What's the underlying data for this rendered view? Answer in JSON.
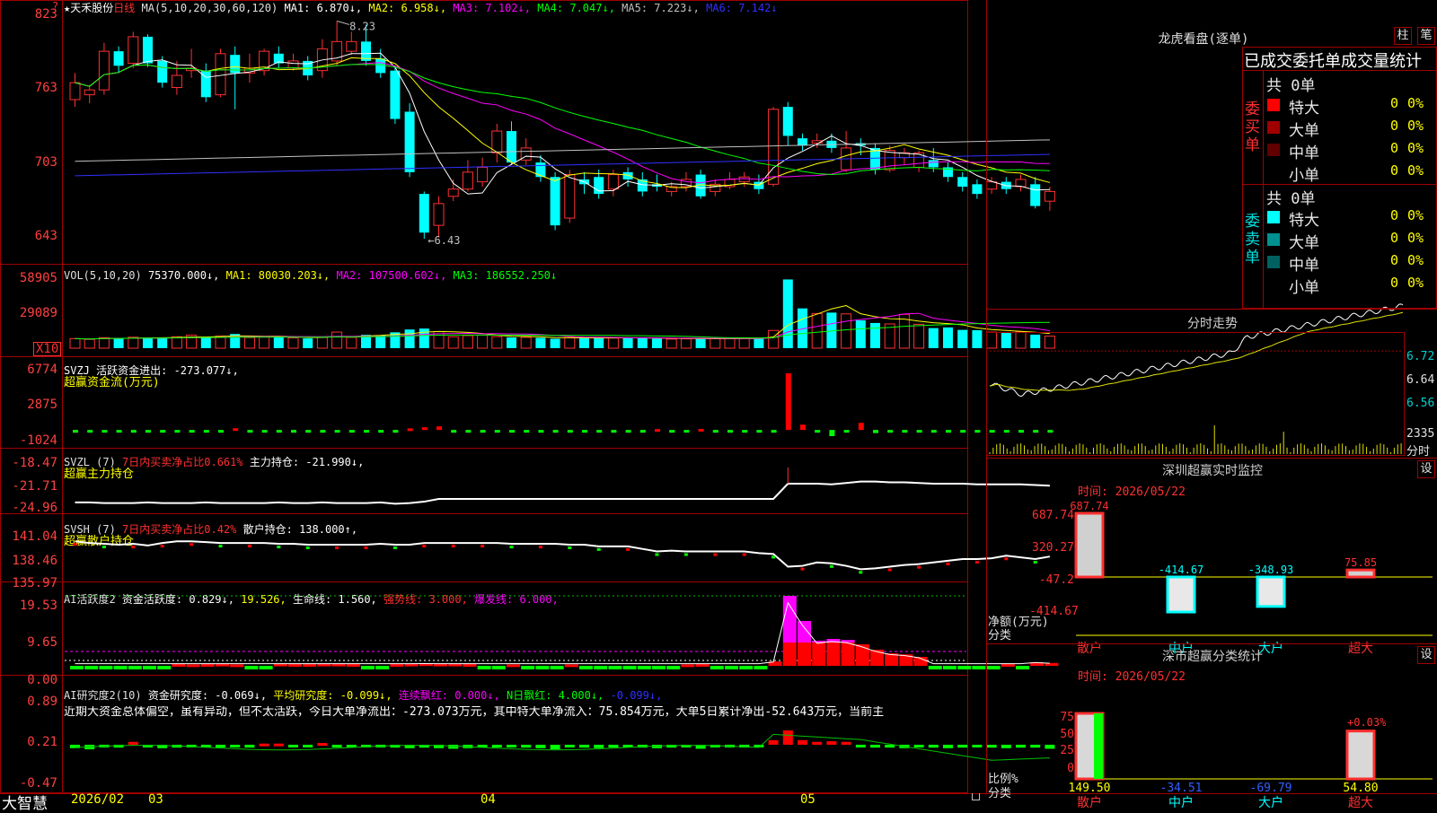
{
  "stock": {
    "star": "★",
    "name": "天禾股份",
    "period": "日线"
  },
  "ma_header": {
    "label": "MA(5,10,20,30,60,120)",
    "items": [
      {
        "text": "MA1: 6.870↓,",
        "color": "#ffffff"
      },
      {
        "text": "MA2: 6.958↓,",
        "color": "#ffff00"
      },
      {
        "text": "MA3: 7.102↓,",
        "color": "#ff00ff"
      },
      {
        "text": "MA4: 7.047↓,",
        "color": "#00ff00"
      },
      {
        "text": "MA5: 7.223↓,",
        "color": "#c0c0c0"
      },
      {
        "text": "MA6: 7.142↓",
        "color": "#3030ff"
      }
    ],
    "high_label": "8.23",
    "low_label": "←6.43"
  },
  "y_axes": {
    "price": [
      "823",
      "763",
      "703",
      "643"
    ],
    "vol": [
      "58905",
      "29089"
    ],
    "vol_unit": "X10",
    "svzj": [
      "6774",
      "2875",
      "-1024"
    ],
    "svzl": [
      "-18.47",
      "-21.71",
      "-24.96"
    ],
    "svsh": [
      "141.04",
      "138.46",
      "135.97"
    ],
    "ai": [
      "19.53",
      "9.65",
      "0.00"
    ],
    "air": [
      "0.89",
      "0.21",
      "-0.47"
    ]
  },
  "vol_header": {
    "label": "VOL(5,10,20)",
    "value": "75370.000↓,",
    "items": [
      {
        "text": "MA1: 80030.203↓,",
        "color": "#ffff00"
      },
      {
        "text": "MA2: 107500.602↓,",
        "color": "#ff00ff"
      },
      {
        "text": "MA3: 186552.250↓",
        "color": "#00ff00"
      }
    ]
  },
  "svzj_header": {
    "line1": "SVZJ  活跃资金进出: -273.077↓,",
    "line2": "超赢资金流(万元)"
  },
  "svzl_header": {
    "prefix": "SVZL (7)",
    "red": "7日内买卖净占比0.661%",
    "rest": "主力持仓: -21.990↓,",
    "line2": "超赢主力持仓"
  },
  "svsh_header": {
    "prefix": "SVSH (7)",
    "red": "7日内买卖净占比0.42%",
    "rest": "散户持仓: 138.000↑,",
    "line2": "超赢散户持仓"
  },
  "ai_header": {
    "label": "AI活跃度2",
    "items": [
      {
        "text": "资金活跃度: 0.829↓,",
        "color": "#ffffff"
      },
      {
        "text": "19.526,",
        "color": "#ffff00"
      },
      {
        "text": "生命线: 1.560,",
        "color": "#ffffff"
      },
      {
        "text": "强势线: 3.000,",
        "color": "#ff3030"
      },
      {
        "text": "爆发线: 6.000,",
        "color": "#ff00ff"
      }
    ]
  },
  "air_header": {
    "label": "AI研究度2(10)",
    "items": [
      {
        "text": "资金研究度: -0.069↓,",
        "color": "#ffffff"
      },
      {
        "text": "平均研究度: -0.099↓,",
        "color": "#ffff00"
      },
      {
        "text": "连续飘红: 0.000↓,",
        "color": "#ff00ff"
      },
      {
        "text": "N日飘红: 4.000↓,",
        "color": "#00ff00"
      },
      {
        "text": "-0.099↓,",
        "color": "#3030ff"
      }
    ],
    "comment": "近期大资金总体偏空，虽有异动，但不太活跃，今日大单净流出：-273.073万元，其中特大单净流入：75.854万元，大单5日累计净出-52.643万元，当前主"
  },
  "bottom_bar": {
    "brand": "大智慧",
    "x_labels": [
      "2026/02",
      "03",
      "04",
      "05"
    ]
  },
  "dragon": {
    "title": "龙虎看盘(逐单)",
    "btn_zhu": "柱",
    "btn_bi": "笔",
    "sub_title": "已成交委托单成交量统计",
    "buy_side": "委买单",
    "sell_side": "委卖单",
    "buy_total": "共 0单",
    "sell_total": "共 0单",
    "buy_rows": [
      {
        "name": "特大",
        "count": "0",
        "pct": "0%",
        "color": "#ff0000"
      },
      {
        "name": "大单",
        "count": "0",
        "pct": "0%",
        "color": "#a00000"
      },
      {
        "name": "中单",
        "count": "0",
        "pct": "0%",
        "color": "#600000"
      },
      {
        "name": "小单",
        "count": "0",
        "pct": "0%",
        "color": "#000000"
      }
    ],
    "sell_rows": [
      {
        "name": "特大",
        "count": "0",
        "pct": "0%",
        "color": "#00ffff"
      },
      {
        "name": "大单",
        "count": "0",
        "pct": "0%",
        "color": "#009090"
      },
      {
        "name": "中单",
        "count": "0",
        "pct": "0%",
        "color": "#006060"
      },
      {
        "name": "小单",
        "count": "0",
        "pct": "0%",
        "color": "#000000"
      }
    ]
  },
  "minute": {
    "title": "分时走势",
    "y_labels": [
      "6.72",
      "6.64",
      "6.56"
    ],
    "vol_label": "2335",
    "vol_unit": "分时"
  },
  "monitor": {
    "title": "深圳超赢实时监控",
    "btn": "设",
    "time": "时间: 2026/05/22",
    "y_labels": [
      "687.74",
      "320.27",
      "-47.2",
      "-414.67"
    ],
    "y_title": "净额(万元)",
    "x_title": "分类"
  },
  "classify": {
    "title": "深市超赢分类统计",
    "btn": "设",
    "time": "时间: 2026/05/22",
    "y_labels": [
      "75",
      "50",
      "25",
      "0"
    ],
    "pct_label": "+0.03%",
    "y_title": "比例%",
    "x_title": "分类"
  },
  "chart_data": [
    {
      "type": "candlestick",
      "title": "天禾股份 日线",
      "ylim": [
        6.4,
        8.3
      ],
      "candles": [
        [
          7.58,
          7.72,
          7.8,
          7.52
        ],
        [
          7.62,
          7.66,
          7.7,
          7.55
        ],
        [
          7.66,
          7.98,
          8.05,
          7.62
        ],
        [
          7.98,
          7.86,
          8.02,
          7.8
        ],
        [
          7.88,
          8.1,
          8.14,
          7.84
        ],
        [
          8.1,
          7.88,
          8.12,
          7.85
        ],
        [
          7.9,
          7.72,
          7.94,
          7.68
        ],
        [
          7.68,
          7.78,
          7.9,
          7.62
        ],
        [
          7.82,
          7.84,
          8.0,
          7.76
        ],
        [
          7.82,
          7.6,
          7.88,
          7.56
        ],
        [
          7.62,
          7.96,
          8.0,
          7.6
        ],
        [
          7.95,
          7.8,
          8.02,
          7.5
        ],
        [
          7.8,
          7.84,
          7.96,
          7.72
        ],
        [
          7.82,
          7.98,
          8.0,
          7.78
        ],
        [
          7.96,
          7.88,
          8.02,
          7.84
        ],
        [
          7.84,
          7.9,
          7.96,
          7.82
        ],
        [
          7.9,
          7.78,
          7.94,
          7.74
        ],
        [
          7.82,
          8.0,
          8.08,
          7.76
        ],
        [
          7.9,
          8.06,
          8.23,
          7.86
        ],
        [
          7.98,
          8.06,
          8.14,
          7.95
        ],
        [
          8.06,
          7.9,
          8.2,
          7.86
        ],
        [
          7.92,
          7.8,
          8.0,
          7.76
        ],
        [
          7.82,
          7.42,
          7.86,
          7.38
        ],
        [
          7.48,
          6.98,
          7.55,
          6.94
        ],
        [
          6.8,
          6.48,
          6.82,
          6.43
        ],
        [
          6.54,
          6.72,
          6.78,
          6.44
        ],
        [
          6.78,
          6.84,
          6.92,
          6.74
        ],
        [
          6.84,
          6.98,
          7.08,
          6.82
        ],
        [
          6.9,
          7.02,
          7.1,
          6.86
        ],
        [
          7.14,
          7.32,
          7.38,
          7.06
        ],
        [
          7.32,
          7.06,
          7.4,
          7.04
        ],
        [
          7.08,
          7.18,
          7.26,
          7.04
        ],
        [
          7.06,
          6.94,
          7.12,
          6.9
        ],
        [
          6.94,
          6.54,
          6.98,
          6.5
        ],
        [
          6.6,
          6.96,
          7.0,
          6.56
        ],
        [
          6.92,
          6.88,
          6.98,
          6.8
        ],
        [
          6.94,
          6.8,
          7.0,
          6.76
        ],
        [
          6.84,
          6.96,
          7.0,
          6.78
        ],
        [
          6.98,
          6.92,
          7.02,
          6.86
        ],
        [
          6.92,
          6.82,
          6.98,
          6.78
        ],
        [
          6.88,
          6.86,
          6.96,
          6.82
        ],
        [
          6.82,
          6.86,
          6.9,
          6.78
        ],
        [
          6.86,
          6.92,
          6.98,
          6.82
        ],
        [
          6.96,
          6.78,
          7.0,
          6.76
        ],
        [
          6.82,
          6.88,
          6.92,
          6.78
        ],
        [
          6.86,
          6.92,
          6.98,
          6.84
        ],
        [
          6.9,
          6.94,
          6.98,
          6.86
        ],
        [
          6.9,
          6.84,
          6.96,
          6.8
        ],
        [
          6.88,
          7.5,
          7.52,
          6.86
        ],
        [
          7.52,
          7.28,
          7.56,
          7.2
        ],
        [
          7.26,
          7.2,
          7.3,
          7.16
        ],
        [
          7.22,
          7.24,
          7.3,
          7.18
        ],
        [
          7.24,
          7.18,
          7.3,
          7.14
        ],
        [
          7.0,
          7.18,
          7.32,
          6.98
        ],
        [
          7.22,
          7.2,
          7.26,
          7.12
        ],
        [
          7.18,
          7.0,
          7.22,
          6.96
        ],
        [
          7.0,
          7.16,
          7.2,
          6.98
        ],
        [
          7.1,
          7.14,
          7.18,
          7.04
        ],
        [
          7.02,
          7.14,
          7.16,
          6.98
        ],
        [
          7.08,
          7.02,
          7.18,
          6.98
        ],
        [
          7.02,
          6.94,
          7.06,
          6.9
        ],
        [
          6.94,
          6.86,
          6.98,
          6.82
        ],
        [
          6.88,
          6.8,
          6.92,
          6.76
        ],
        [
          6.84,
          6.9,
          6.94,
          6.8
        ],
        [
          6.9,
          6.84,
          6.94,
          6.8
        ],
        [
          6.86,
          6.92,
          6.96,
          6.82
        ],
        [
          6.88,
          6.7,
          6.94,
          6.68
        ],
        [
          6.74,
          6.82,
          6.86,
          6.66
        ]
      ]
    },
    {
      "type": "bar",
      "title": "VOL(5,10,20)",
      "ylim": [
        0,
        60000
      ],
      "values": [
        8200,
        7600,
        9000,
        8800,
        9400,
        9000,
        8600,
        9800,
        11200,
        9500,
        10400,
        12200,
        9100,
        9600,
        10000,
        8800,
        8400,
        9300,
        13800,
        9300,
        11400,
        11000,
        13600,
        16000,
        16800,
        14200,
        9800,
        10800,
        11200,
        9900,
        9200,
        9300,
        8900,
        8100,
        9200,
        8700,
        8900,
        8800,
        8900,
        8500,
        8300,
        7800,
        8000,
        8100,
        8200,
        8200,
        8400,
        8100,
        15200,
        58900,
        34100,
        29700,
        30500,
        29400,
        23900,
        21600,
        20800,
        29000,
        20500,
        17200,
        17800,
        15700,
        15400,
        13800,
        13200,
        14100,
        11600,
        10300
      ]
    },
    {
      "type": "bar",
      "title": "SVZJ 活跃资金进出",
      "ylim": [
        -1100,
        6800
      ],
      "values": [
        -200,
        -180,
        -150,
        -160,
        -100,
        -120,
        -140,
        -110,
        -90,
        -120,
        -150,
        200,
        -100,
        -110,
        -130,
        -90,
        -100,
        -110,
        -80,
        -120,
        -100,
        -130,
        -160,
        180,
        300,
        400,
        -200,
        -180,
        -150,
        -90,
        -110,
        -120,
        -100,
        -140,
        -160,
        -110,
        -90,
        -130,
        -100,
        -90,
        100,
        -120,
        -100,
        120,
        -80,
        -110,
        -90,
        -100,
        -150,
        6400,
        600,
        -180,
        -700,
        -200,
        800,
        -350,
        -200,
        -180,
        -160,
        -150,
        -190,
        -220,
        -200,
        -170,
        -160,
        -180,
        -150,
        -273
      ]
    },
    {
      "type": "line",
      "title": "SVZL 主力持仓",
      "ylim": [
        -25.2,
        -18.2
      ],
      "values": [
        -24.4,
        -24.4,
        -24.5,
        -24.5,
        -24.5,
        -24.4,
        -24.5,
        -24.5,
        -24.5,
        -24.4,
        -24.5,
        -24.5,
        -24.5,
        -24.5,
        -24.4,
        -24.5,
        -24.5,
        -24.4,
        -24.5,
        -24.5,
        -24.5,
        -24.4,
        -24.6,
        -24.5,
        -24.3,
        -23.9,
        -23.9,
        -23.9,
        -23.9,
        -23.9,
        -23.9,
        -23.9,
        -23.9,
        -23.9,
        -23.9,
        -23.9,
        -23.9,
        -23.9,
        -23.9,
        -23.9,
        -23.9,
        -23.9,
        -23.9,
        -23.9,
        -23.9,
        -23.9,
        -23.9,
        -23.9,
        -23.9,
        -21.7,
        -21.7,
        -21.7,
        -21.8,
        -21.6,
        -21.4,
        -21.4,
        -21.5,
        -21.5,
        -21.6,
        -21.7,
        -21.7,
        -21.7,
        -21.8,
        -21.8,
        -21.8,
        -21.8,
        -21.9,
        -21.99
      ]
    },
    {
      "type": "line",
      "title": "SVSH 散户持仓",
      "ylim": [
        135.9,
        141.2
      ],
      "values": [
        139.8,
        139.6,
        139.5,
        139.4,
        139.5,
        139.3,
        139.6,
        139.8,
        139.8,
        139.7,
        139.6,
        139.6,
        139.6,
        139.6,
        139.5,
        139.5,
        139.4,
        139.4,
        139.4,
        139.4,
        139.4,
        139.5,
        139.4,
        139.4,
        139.6,
        139.6,
        139.6,
        139.6,
        139.6,
        139.6,
        139.5,
        139.5,
        139.5,
        139.5,
        139.4,
        139.4,
        139.2,
        139.2,
        139.2,
        138.9,
        138.6,
        138.7,
        138.6,
        138.6,
        138.6,
        138.6,
        138.6,
        138.4,
        138.3,
        136.8,
        136.9,
        137.3,
        137.2,
        136.9,
        136.5,
        136.6,
        136.8,
        137.0,
        137.1,
        137.3,
        137.5,
        137.7,
        137.7,
        137.8,
        138.1,
        137.9,
        137.7,
        138.0
      ]
    },
    {
      "type": "bar",
      "title": "AI活跃度2",
      "ylim": [
        -0.8,
        20.5
      ],
      "thresholds": [
        3.0,
        6.0
      ],
      "values": [
        -0.5,
        -0.4,
        -0.6,
        -0.5,
        -0.5,
        -0.4,
        -0.5,
        0.5,
        0.4,
        0.5,
        0.6,
        0.4,
        -0.5,
        -0.5,
        0.6,
        0.5,
        0.5,
        0.6,
        0.6,
        0.5,
        -0.4,
        -0.5,
        0.5,
        0.6,
        0.7,
        0.6,
        0.6,
        0.5,
        -0.4,
        -0.5,
        0.4,
        -0.5,
        -0.5,
        -0.6,
        0.4,
        -0.4,
        -0.5,
        -0.5,
        -0.4,
        -0.4,
        -0.4,
        -0.5,
        0.4,
        0.5,
        -0.5,
        -0.4,
        -0.5,
        -0.4,
        1.2,
        19.5,
        12.5,
        7.0,
        7.5,
        7.2,
        6.0,
        4.5,
        3.5,
        3.2,
        2.5,
        -0.5,
        -0.5,
        -0.6,
        -0.5,
        -0.4,
        0.5,
        -0.4,
        1.0,
        0.8
      ]
    },
    {
      "type": "bar",
      "title": "AI研究度2(10)",
      "ylim": [
        -0.47,
        0.89
      ],
      "values": [
        -0.06,
        -0.08,
        -0.04,
        -0.05,
        0.05,
        -0.04,
        -0.06,
        -0.05,
        -0.04,
        -0.05,
        -0.05,
        -0.04,
        -0.05,
        0.02,
        0.02,
        -0.03,
        -0.04,
        0.03,
        -0.02,
        -0.03,
        -0.03,
        -0.02,
        -0.05,
        -0.06,
        -0.05,
        -0.06,
        -0.07,
        -0.06,
        -0.05,
        -0.04,
        -0.04,
        -0.05,
        -0.06,
        -0.08,
        -0.04,
        -0.05,
        -0.06,
        -0.05,
        -0.04,
        -0.05,
        -0.06,
        -0.05,
        -0.04,
        -0.07,
        -0.04,
        -0.04,
        -0.05,
        -0.04,
        0.08,
        0.25,
        0.08,
        0.05,
        0.06,
        0.05,
        -0.04,
        -0.05,
        -0.05,
        -0.06,
        -0.04,
        -0.05,
        -0.06,
        -0.05,
        -0.04,
        -0.05,
        -0.06,
        -0.05,
        -0.05,
        -0.07
      ]
    },
    {
      "type": "bar",
      "title": "深圳超赢实时监控",
      "categories": [
        "散户",
        "中户",
        "大户",
        "超大"
      ],
      "values": [
        687.74,
        -414.67,
        -348.93,
        75.85
      ],
      "ylim": [
        -414.67,
        687.74
      ]
    },
    {
      "type": "bar",
      "title": "深市超赢分类统计",
      "categories": [
        "散户",
        "中户",
        "大户",
        "超大"
      ],
      "values": [
        149.5,
        -34.51,
        -69.79,
        54.8
      ],
      "ylim": [
        0,
        75
      ]
    }
  ]
}
